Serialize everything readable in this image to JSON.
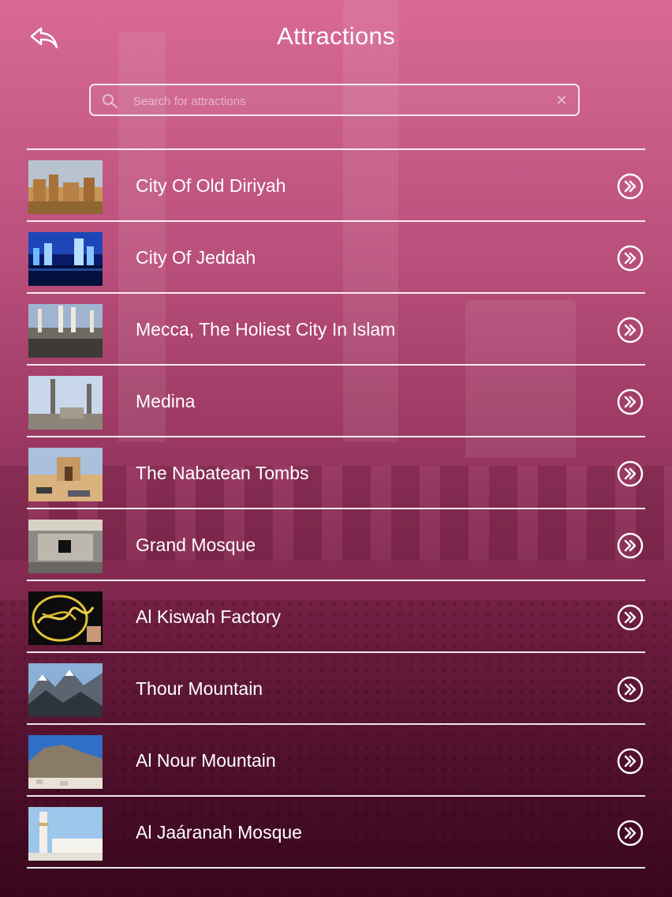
{
  "header": {
    "title": "Attractions",
    "back_icon": "back-arrow-icon"
  },
  "search": {
    "placeholder": "Search for attractions",
    "value": "",
    "icon": "search-icon",
    "clear_label": "✕"
  },
  "attractions": [
    {
      "label": "City Of Old Diriyah",
      "thumbnail": "mud-brick-ruins"
    },
    {
      "label": "City Of Jeddah",
      "thumbnail": "night-skyline"
    },
    {
      "label": "Mecca, The Holiest City In Islam",
      "thumbnail": "mosque-minarets"
    },
    {
      "label": "Medina",
      "thumbnail": "minarets-sky"
    },
    {
      "label": "The Nabatean Tombs",
      "thumbnail": "desert-tomb"
    },
    {
      "label": "Grand Mosque",
      "thumbnail": "kaaba-crowd"
    },
    {
      "label": "Al Kiswah Factory",
      "thumbnail": "gold-calligraphy"
    },
    {
      "label": "Thour Mountain",
      "thumbnail": "rocky-mountains"
    },
    {
      "label": "Al Nour Mountain",
      "thumbnail": "hill-town"
    },
    {
      "label": "Al Jaáranah Mosque",
      "thumbnail": "white-minaret"
    }
  ],
  "colors": {
    "background_top": "#d86a95",
    "background_bottom": "#4e1028",
    "divider": "#ffffff"
  }
}
